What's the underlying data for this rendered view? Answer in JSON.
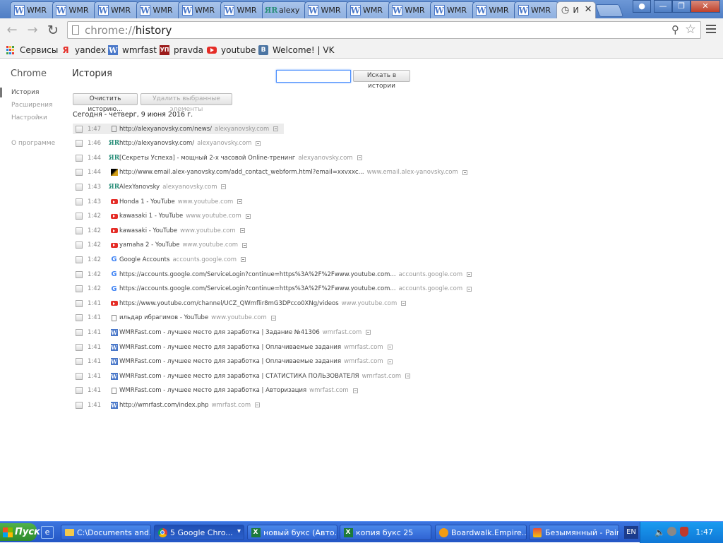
{
  "tabs": [
    {
      "title": "WMR",
      "icon": "w-icon"
    },
    {
      "title": "WMR",
      "icon": "w-icon"
    },
    {
      "title": "WMR",
      "icon": "w-icon"
    },
    {
      "title": "WMR",
      "icon": "w-icon"
    },
    {
      "title": "WMR",
      "icon": "w-icon"
    },
    {
      "title": "WMR",
      "icon": "w-icon"
    },
    {
      "title": "alexy",
      "icon": "ar-icon"
    },
    {
      "title": "WMR",
      "icon": "w-icon"
    },
    {
      "title": "WMR",
      "icon": "w-icon"
    },
    {
      "title": "WMR",
      "icon": "w-icon"
    },
    {
      "title": "WMR",
      "icon": "w-icon"
    },
    {
      "title": "WMR",
      "icon": "w-icon"
    },
    {
      "title": "WMR",
      "icon": "w-icon"
    },
    {
      "title": "И",
      "icon": "history-icon",
      "active": true
    }
  ],
  "omnibox": {
    "scheme": "chrome://",
    "path": "history"
  },
  "bookmarks": [
    {
      "label": "Сервисы",
      "icon": "apps-grid-icon"
    },
    {
      "label": "yandex",
      "icon": "yandex-icon"
    },
    {
      "label": "wmrfast",
      "icon": "w-icon"
    },
    {
      "label": "pravda",
      "icon": "pravda-icon"
    },
    {
      "label": "youtube",
      "icon": "youtube-icon"
    },
    {
      "label": "Welcome! | VK",
      "icon": "vk-icon"
    }
  ],
  "sidebar": {
    "brand": "Chrome",
    "items": [
      {
        "label": "История",
        "selected": true
      },
      {
        "label": "Расширения"
      },
      {
        "label": "Настройки"
      },
      {
        "label": "О программе"
      }
    ]
  },
  "page": {
    "title": "История",
    "search_button": "Искать в истории",
    "clear_button": "Очистить историю...",
    "remove_button": "Удалить выбранные элементы",
    "day_header": "Сегодня - четверг, 9 июня 2016 г."
  },
  "history": [
    {
      "time": "1:47",
      "title": "http://alexyanovsky.com/news/",
      "domain": "alexyanovsky.com",
      "icon": "page"
    },
    {
      "time": "1:46",
      "title": "http://alexyanovsky.com/",
      "domain": "alexyanovsky.com",
      "icon": "ar"
    },
    {
      "time": "1:44",
      "title": "[Секреты Успеха] - мощный 2-х часовой Online-тренинг",
      "domain": "alexyanovsky.com",
      "icon": "ar"
    },
    {
      "time": "1:44",
      "title": "http://www.email.alex-yanovsky.com/add_contact_webform.html?email=xxvxxc...",
      "domain": "www.email.alex-yanovsky.com",
      "icon": "em"
    },
    {
      "time": "1:43",
      "title": "AlexYanovsky",
      "domain": "alexyanovsky.com",
      "icon": "ar"
    },
    {
      "time": "1:43",
      "title": "Honda 1 - YouTube",
      "domain": "www.youtube.com",
      "icon": "yt"
    },
    {
      "time": "1:42",
      "title": "kawasaki 1 - YouTube",
      "domain": "www.youtube.com",
      "icon": "yt"
    },
    {
      "time": "1:42",
      "title": "kawasaki - YouTube",
      "domain": "www.youtube.com",
      "icon": "yt"
    },
    {
      "time": "1:42",
      "title": "yamaha 2 - YouTube",
      "domain": "www.youtube.com",
      "icon": "yt"
    },
    {
      "time": "1:42",
      "title": "Google Accounts",
      "domain": "accounts.google.com",
      "icon": "g"
    },
    {
      "time": "1:42",
      "title": "https://accounts.google.com/ServiceLogin?continue=https%3A%2F%2Fwww.youtube.com...",
      "domain": "accounts.google.com",
      "icon": "g"
    },
    {
      "time": "1:42",
      "title": "https://accounts.google.com/ServiceLogin?continue=https%3A%2F%2Fwww.youtube.com...",
      "domain": "accounts.google.com",
      "icon": "g"
    },
    {
      "time": "1:41",
      "title": "https://www.youtube.com/channel/UCZ_QWmflir8mG3DPcco0XNg/videos",
      "domain": "www.youtube.com",
      "icon": "yt"
    },
    {
      "time": "1:41",
      "title": "ильдар ибрагимов - YouTube",
      "domain": "www.youtube.com",
      "icon": "page"
    },
    {
      "time": "1:41",
      "title": "WMRFast.com - лучшее место для заработка | Задание №41306",
      "domain": "wmrfast.com",
      "icon": "w"
    },
    {
      "time": "1:41",
      "title": "WMRFast.com - лучшее место для заработка | Оплачиваемые задания",
      "domain": "wmrfast.com",
      "icon": "w"
    },
    {
      "time": "1:41",
      "title": "WMRFast.com - лучшее место для заработка | Оплачиваемые задания",
      "domain": "wmrfast.com",
      "icon": "w"
    },
    {
      "time": "1:41",
      "title": "WMRFast.com - лучшее место для заработка | СТАТИСТИКА ПОЛЬЗОВАТЕЛЯ",
      "domain": "wmrfast.com",
      "icon": "w"
    },
    {
      "time": "1:41",
      "title": "WMRFast.com - лучшее место для заработка | Авторизация",
      "domain": "wmrfast.com",
      "icon": "page"
    },
    {
      "time": "1:41",
      "title": "http://wmrfast.com/index.php",
      "domain": "wmrfast.com",
      "icon": "w"
    }
  ],
  "taskbar": {
    "start": "Пуск",
    "tasks": [
      {
        "label": "C:\\Documents and...",
        "icon": "folder-icon"
      },
      {
        "label": "5 Google Chro...",
        "icon": "chrome-icon",
        "active": true
      },
      {
        "label": "новый букс (Авто...",
        "icon": "excel-icon"
      },
      {
        "label": "копия букс 25",
        "icon": "excel-icon"
      },
      {
        "label": "Boardwalk.Empire....",
        "icon": "media-icon"
      },
      {
        "label": "Безымянный - Paint",
        "icon": "paint-icon"
      }
    ],
    "lang": "EN",
    "clock": "1:47"
  }
}
